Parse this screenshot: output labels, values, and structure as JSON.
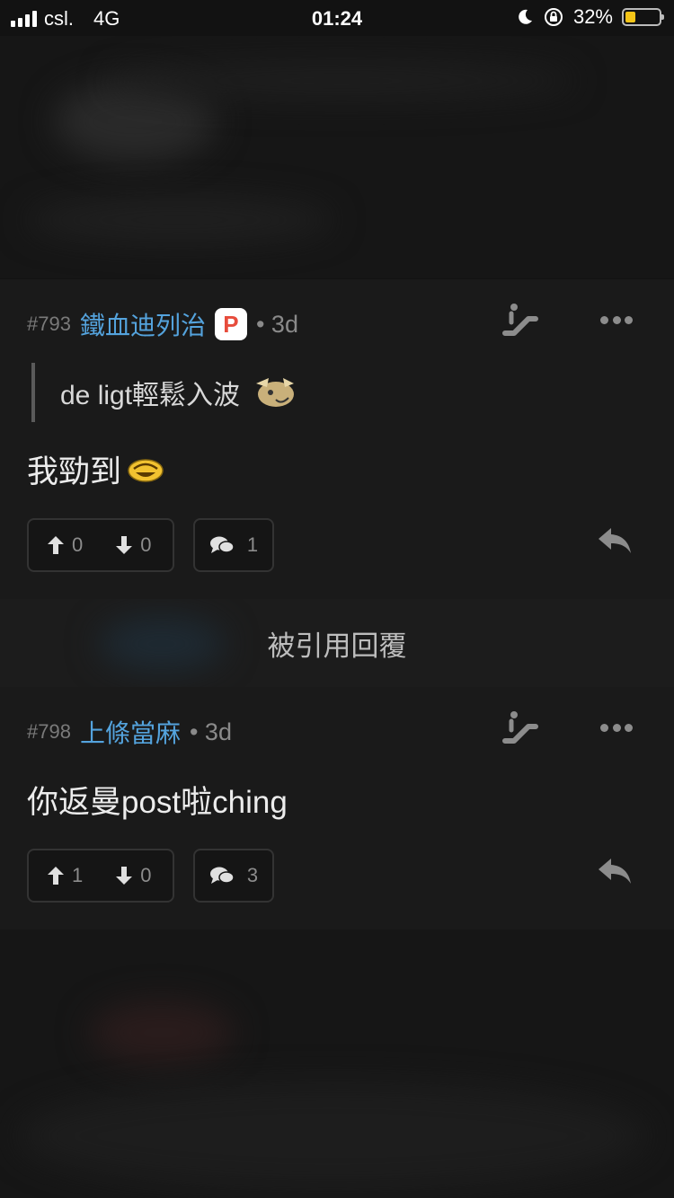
{
  "status": {
    "carrier": "csl.",
    "network": "4G",
    "time": "01:24",
    "battery": "32%",
    "battery_level": 0.32
  },
  "posts": [
    {
      "number": "#793",
      "author": "鐵血迪列治",
      "badge": "P",
      "age": "• 3d",
      "quote": "de ligt輕鬆入波",
      "body": "我勁到",
      "upvotes": "0",
      "downvotes": "0",
      "comments": "1"
    },
    {
      "number": "#798",
      "author": "上條當麻",
      "age": "• 3d",
      "body": "你返曼post啦ching",
      "upvotes": "1",
      "downvotes": "0",
      "comments": "3"
    }
  ],
  "quoted_replies_label": "被引用回覆",
  "colors": {
    "author": "#54a3dd",
    "badge": "#e74c3c",
    "battery": "#f5c518"
  }
}
